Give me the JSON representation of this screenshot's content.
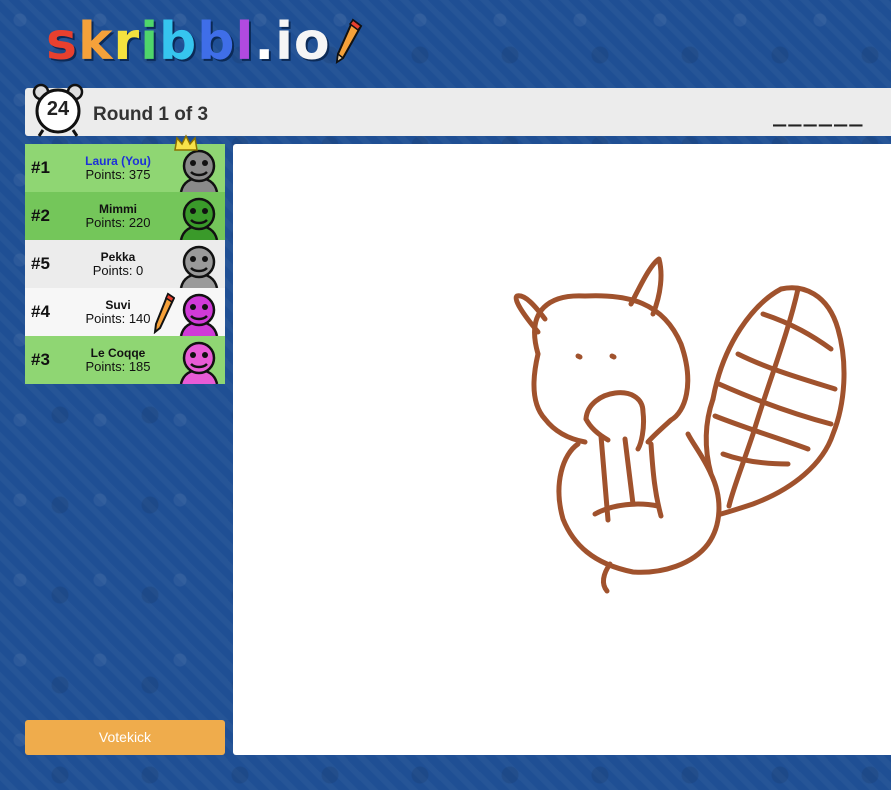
{
  "logo": {
    "letters": [
      "s",
      "k",
      "r",
      "i",
      "b",
      "b",
      "l",
      ".",
      "i",
      "o"
    ],
    "colors": [
      "#e8402e",
      "#f5a13a",
      "#f4e23e",
      "#4fd66b",
      "#36c5ef",
      "#3f6ee8",
      "#b04ae0",
      "#ffffff",
      "#f5f5f5",
      "#f5f5f5"
    ]
  },
  "header": {
    "timer": "24",
    "round_text": "Round 1 of 3",
    "word_hint": "______"
  },
  "players": [
    {
      "rank": "#1",
      "name": "Laura (You)",
      "points": "Points: 375",
      "row": "green",
      "you": true,
      "avatar_color": "#8a8a8a",
      "crown": true,
      "drawing": false
    },
    {
      "rank": "#2",
      "name": "Mimmi",
      "points": "Points: 220",
      "row": "green2",
      "you": false,
      "avatar_color": "#3a9a2a",
      "crown": false,
      "drawing": false
    },
    {
      "rank": "#5",
      "name": "Pekka",
      "points": "Points: 0",
      "row": "white",
      "you": false,
      "avatar_color": "#9a9a9a",
      "crown": false,
      "drawing": false
    },
    {
      "rank": "#4",
      "name": "Suvi",
      "points": "Points: 140",
      "row": "white2",
      "you": false,
      "avatar_color": "#d03ad8",
      "crown": false,
      "drawing": true
    },
    {
      "rank": "#3",
      "name": "Le Coqqe",
      "points": "Points: 185",
      "row": "green",
      "you": false,
      "avatar_color": "#e85bd6",
      "crown": false,
      "drawing": false
    }
  ],
  "votekick_label": "Votekick",
  "canvas": {
    "stroke_color": "#a0522d"
  }
}
